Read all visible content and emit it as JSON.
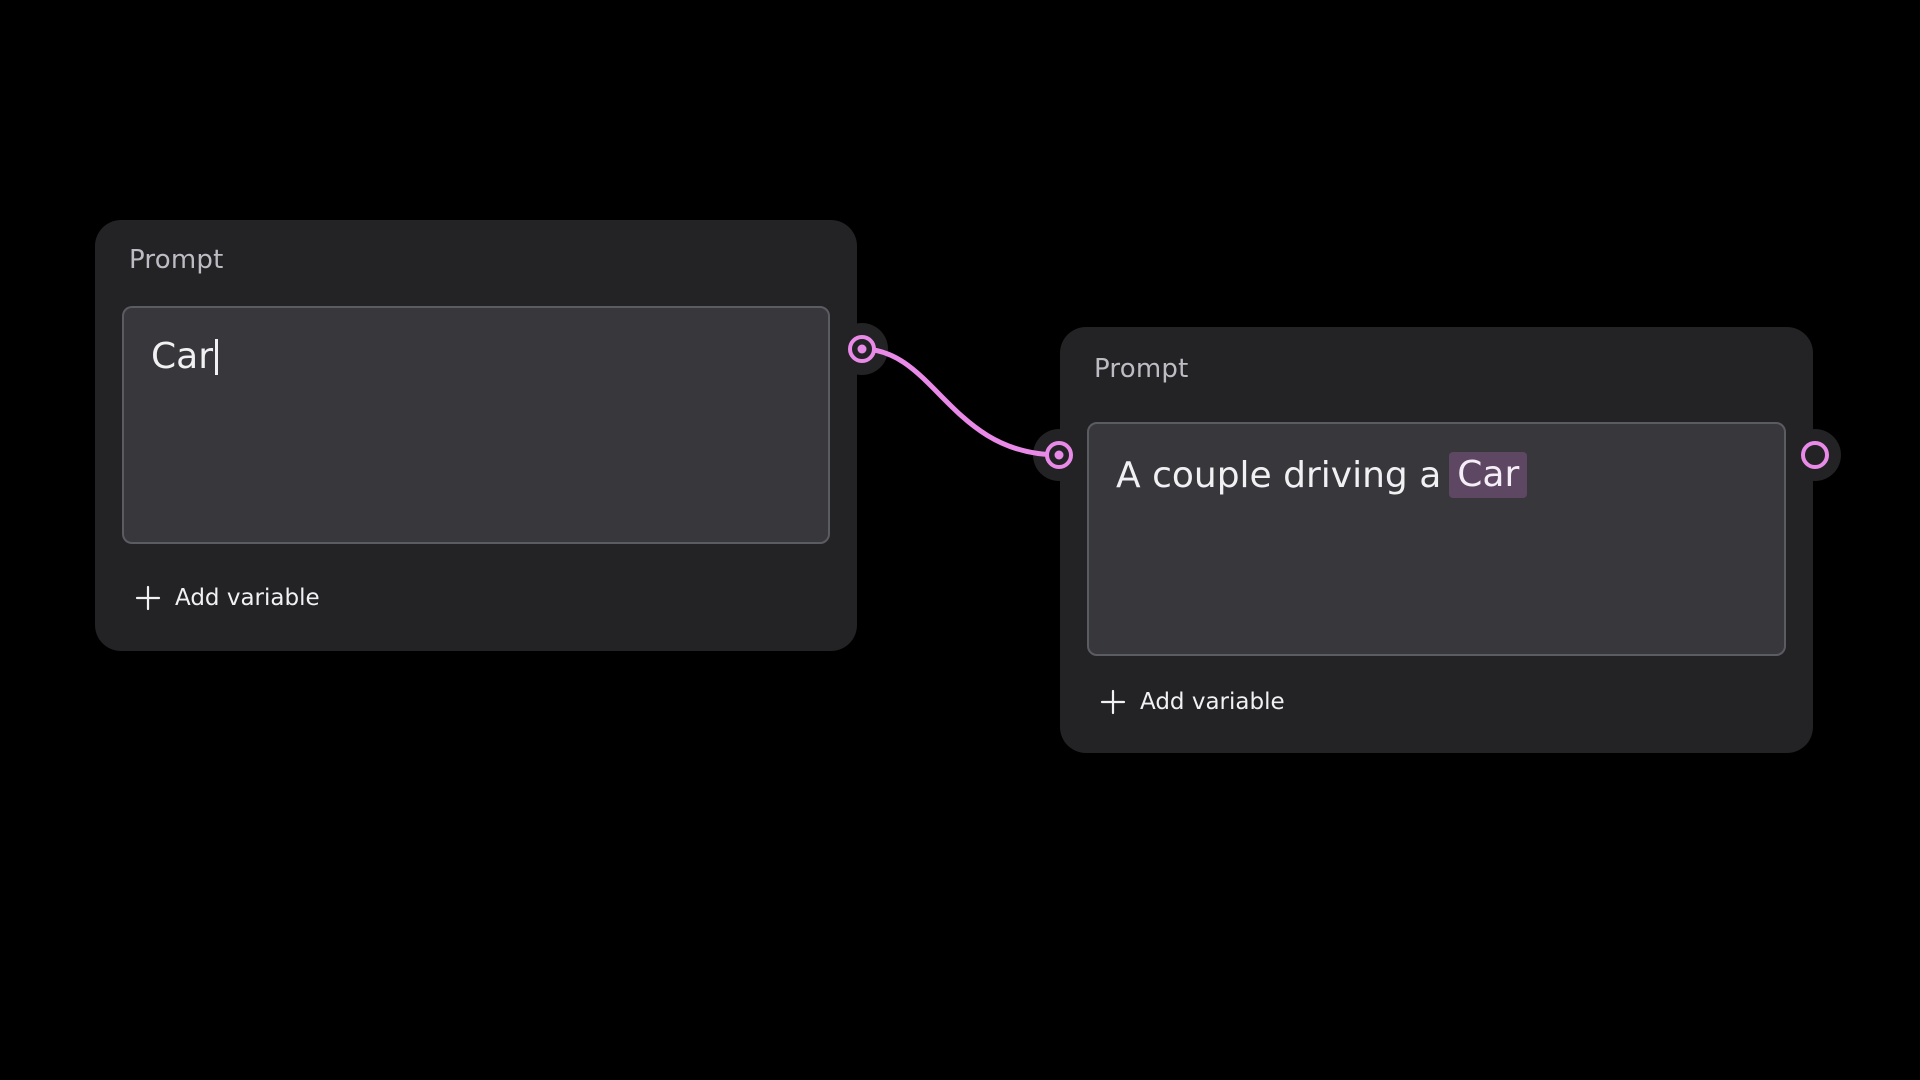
{
  "nodes": [
    {
      "title": "Prompt",
      "field_value": "Car",
      "add_variable_label": "Add variable"
    },
    {
      "title": "Prompt",
      "field_text": "A couple driving a",
      "variable_chip": "Car",
      "add_variable_label": "Add variable"
    }
  ],
  "colors": {
    "background": "#000000",
    "node_bg": "#232326",
    "field_bg": "#37373c",
    "wire_accent": "#e98ae8",
    "chip_bg": "#5e4763"
  }
}
